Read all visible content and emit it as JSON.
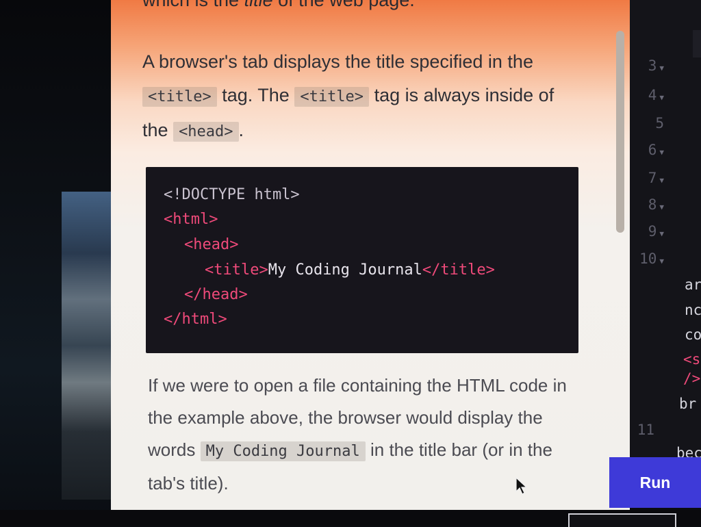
{
  "lesson": {
    "top_line_prefix": "which is the",
    "top_line_italic": "title",
    "top_line_suffix": "of the web page.",
    "para1": {
      "part1": "A browser's tab displays the title specified in the",
      "code1": "<title>",
      "part2": "tag. The",
      "code2": "<title>",
      "part3": "tag is always inside of the",
      "code3": "<head>",
      "part4": "."
    },
    "code_block": {
      "doctype": "<!DOCTYPE html>",
      "html_open": "<html>",
      "head_open": "<head>",
      "title_open": "<title>",
      "title_text": "My Coding Journal",
      "title_close": "</title>",
      "head_close": "</head>",
      "html_close": "</html>"
    },
    "para2": {
      "part1": "If we were to open a file containing the HTML code in the example above, the browser would display the words",
      "code": "My Coding Journal",
      "part2": "in the title bar (or in the tab's title)."
    }
  },
  "editor": {
    "line_numbers": [
      "3",
      "4",
      "5",
      "6",
      "7",
      "8",
      "9",
      "10",
      "11"
    ],
    "text_fragments": [
      "ar",
      "nc",
      "co",
      "<s",
      "/>",
      "br",
      "bec"
    ]
  },
  "run_button": {
    "label": "Run"
  },
  "colors": {
    "run_button_bg": "#3e3ad8",
    "code_tag": "#ef4a7a",
    "code_bg": "#17151c",
    "panel_top": "#f07a44"
  }
}
